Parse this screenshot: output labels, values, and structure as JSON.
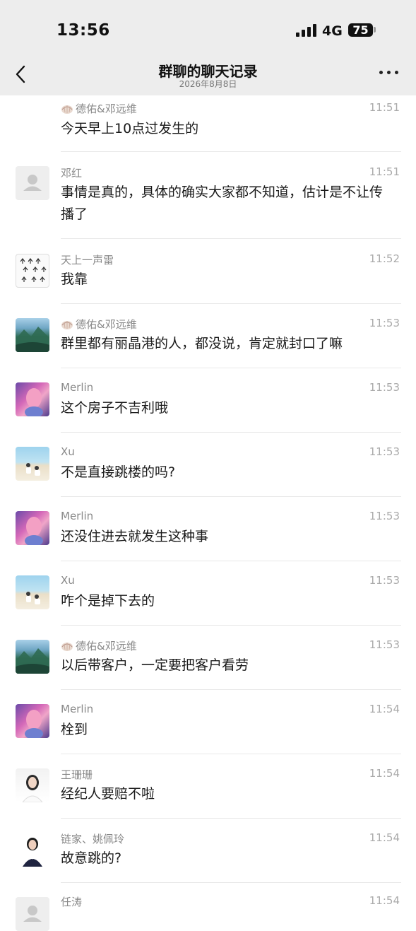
{
  "status_bar": {
    "time": "13:56",
    "network": "4G",
    "battery": "75"
  },
  "header": {
    "title": "群聊的聊天记录",
    "date": "2026年8月8日"
  },
  "messages": [
    {
      "sender": "德佑&邓远维",
      "time": "11:51",
      "text": "今天早上10点过发生的",
      "avatar": "none",
      "shell": true
    },
    {
      "sender": "邓红",
      "time": "11:51",
      "text": "事情是真的，具体的确实大家都不知道，估计是不让传播了",
      "avatar": "default-user-icon",
      "shell": false
    },
    {
      "sender": "天上一声雷",
      "time": "11:52",
      "text": "我靠",
      "avatar": "comic-figures",
      "shell": false
    },
    {
      "sender": "德佑&邓远维",
      "time": "11:53",
      "text": "群里都有丽晶港的人，都没说，肯定就封口了嘛",
      "avatar": "mountain-landscape",
      "shell": true
    },
    {
      "sender": "Merlin",
      "time": "11:53",
      "text": "这个房子不吉利哦",
      "avatar": "pink-hair-girl",
      "shell": false
    },
    {
      "sender": "Xu",
      "time": "11:53",
      "text": "不是直接跳楼的吗?",
      "avatar": "beach-couple",
      "shell": false
    },
    {
      "sender": "Merlin",
      "time": "11:53",
      "text": "还没住进去就发生这种事",
      "avatar": "pink-hair-girl",
      "shell": false
    },
    {
      "sender": "Xu",
      "time": "11:53",
      "text": "咋个是掉下去的",
      "avatar": "beach-couple",
      "shell": false
    },
    {
      "sender": "德佑&邓远维",
      "time": "11:53",
      "text": "以后带客户，一定要把客户看劳",
      "avatar": "mountain-landscape",
      "shell": true
    },
    {
      "sender": "Merlin",
      "time": "11:54",
      "text": "栓到",
      "avatar": "pink-hair-girl",
      "shell": false
    },
    {
      "sender": "王珊珊",
      "time": "11:54",
      "text": "经纪人要赔不啦",
      "avatar": "girl-portrait",
      "shell": false
    },
    {
      "sender": "链家、姚佩玲",
      "time": "11:54",
      "text": "故意跳的?",
      "avatar": "agent-portrait",
      "shell": false
    },
    {
      "sender": "任涛",
      "time": "11:54",
      "text": "",
      "avatar": "default-user-icon",
      "shell": false
    }
  ],
  "colors": {
    "header_bg": "#ededed",
    "page_bg": "#ffffff",
    "divider": "#e8e8e8",
    "meta_text": "#888888"
  }
}
